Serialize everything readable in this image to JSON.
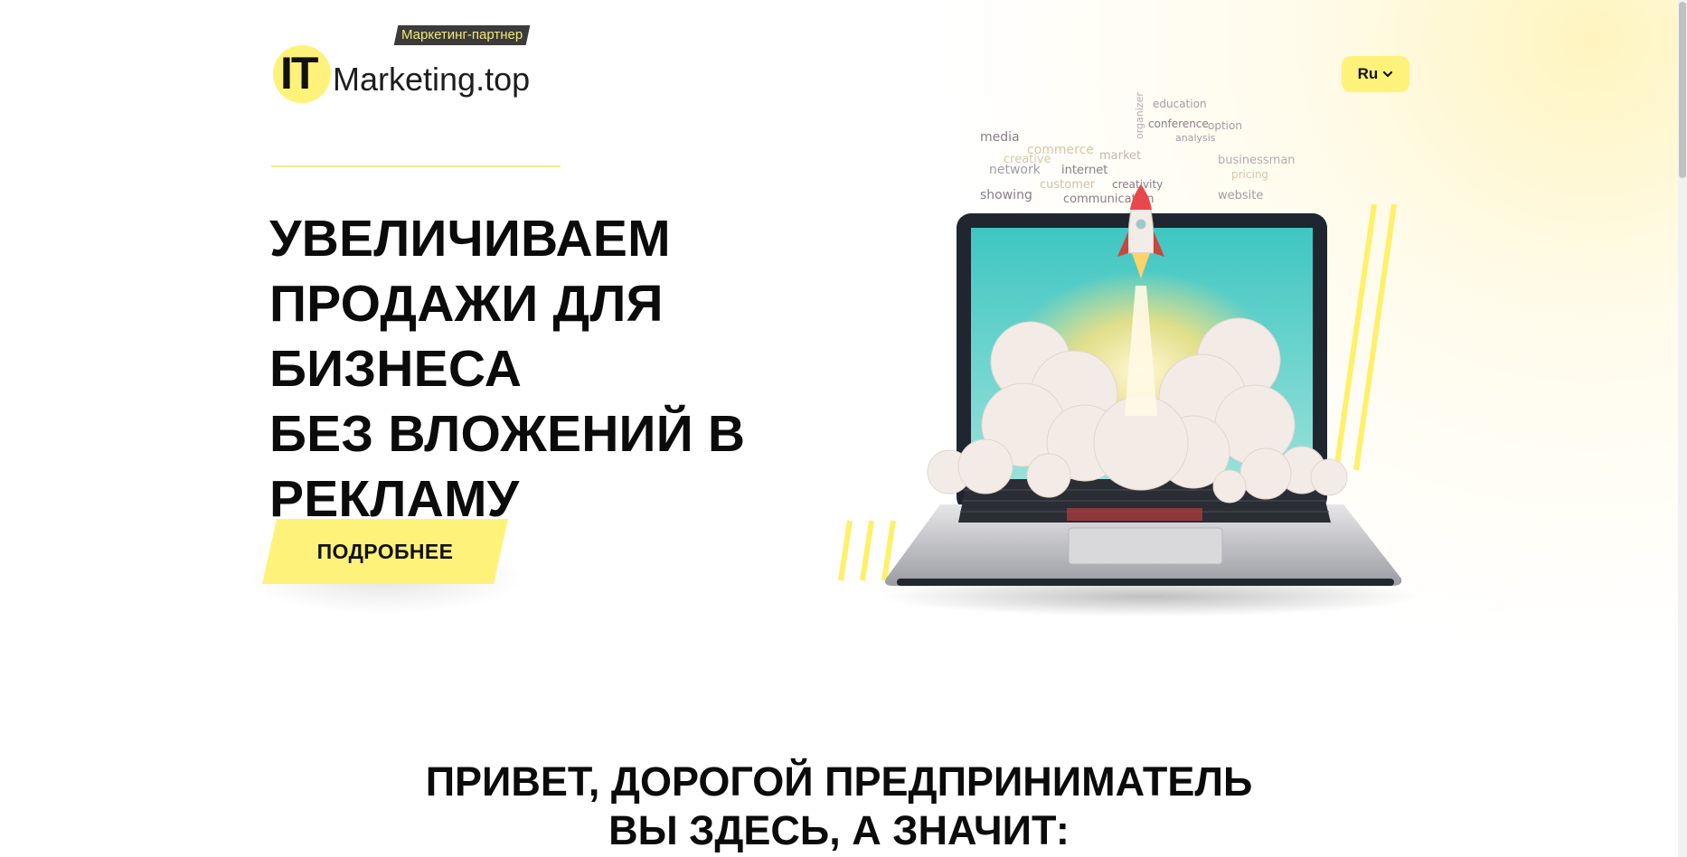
{
  "logo": {
    "badge": "Маркетинг-партнер",
    "mark": "IT",
    "name": "Marketing.top"
  },
  "language": {
    "selected": "Ru"
  },
  "hero": {
    "title_lines": [
      "УВЕЛИЧИВАЕМ",
      "ПРОДАЖИ ДЛЯ БИЗНЕСА",
      "БЕЗ ВЛОЖЕНИЙ В",
      "РЕКЛАМУ"
    ],
    "cta_label": "ПОДРОБНЕЕ"
  },
  "illustration": {
    "words": [
      "media",
      "commerce",
      "creative",
      "network",
      "internet",
      "market",
      "customer",
      "creativity",
      "showing",
      "communication",
      "education",
      "conference",
      "option",
      "analysis",
      "organizer",
      "businessman",
      "pricing",
      "website"
    ]
  },
  "section": {
    "line1": "ПРИВЕТ, ДОРОГОЙ ПРЕДПРИНИМАТЕЛЬ",
    "line2": "ВЫ ЗДЕСЬ, А ЗНАЧИТ:"
  },
  "colors": {
    "accent": "#fff27a",
    "text": "#0b0b0b",
    "badge_bg": "#3b3b3b"
  }
}
